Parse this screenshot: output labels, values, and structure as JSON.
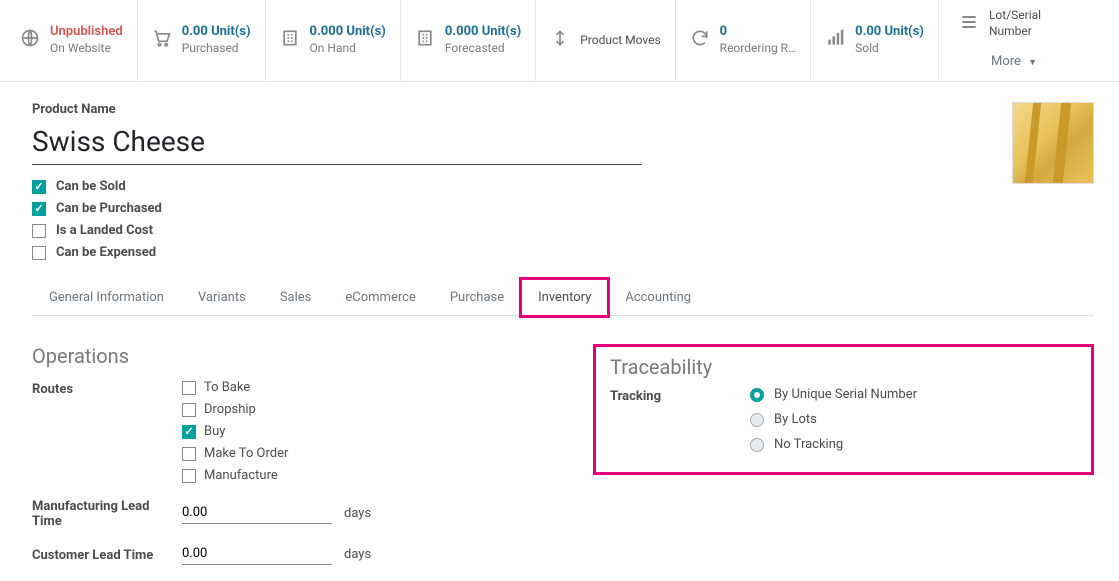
{
  "stats": {
    "website": {
      "status": "Unpublished",
      "label": "On Website"
    },
    "purchased": {
      "value": "0.00 Unit(s)",
      "label": "Purchased"
    },
    "onhand": {
      "value": "0.000 Unit(s)",
      "label": "On Hand"
    },
    "forecasted": {
      "value": "0.000 Unit(s)",
      "label": "Forecasted"
    },
    "moves": {
      "label": "Product Moves"
    },
    "reordering": {
      "value": "0",
      "label": "Reordering R…"
    },
    "sold": {
      "value": "0.00 Unit(s)",
      "label": "Sold"
    },
    "lotserial": {
      "line1": "Lot/Serial",
      "line2": "Number"
    },
    "more": "More"
  },
  "form": {
    "name_label": "Product Name",
    "name_value": "Swiss Cheese",
    "checkboxes": {
      "sold": {
        "label": "Can be Sold",
        "checked": true
      },
      "purchased": {
        "label": "Can be Purchased",
        "checked": true
      },
      "landed": {
        "label": "Is a Landed Cost",
        "checked": false
      },
      "expensed": {
        "label": "Can be Expensed",
        "checked": false
      }
    }
  },
  "tabs": {
    "general": "General Information",
    "variants": "Variants",
    "sales": "Sales",
    "ecommerce": "eCommerce",
    "purchase": "Purchase",
    "inventory": "Inventory",
    "accounting": "Accounting"
  },
  "inventory": {
    "operations_title": "Operations",
    "routes_label": "Routes",
    "routes": {
      "bake": {
        "label": "To Bake",
        "checked": false
      },
      "dropship": {
        "label": "Dropship",
        "checked": false
      },
      "buy": {
        "label": "Buy",
        "checked": true
      },
      "mto": {
        "label": "Make To Order",
        "checked": false
      },
      "manufacture": {
        "label": "Manufacture",
        "checked": false
      }
    },
    "mfg_lead_label": "Manufacturing Lead Time",
    "mfg_lead_value": "0.00",
    "cust_lead_label": "Customer Lead Time",
    "cust_lead_value": "0.00",
    "days_unit": "days",
    "traceability_title": "Traceability",
    "tracking_label": "Tracking",
    "tracking": {
      "serial": {
        "label": "By Unique Serial Number",
        "selected": true
      },
      "lots": {
        "label": "By Lots",
        "selected": false
      },
      "none": {
        "label": "No Tracking",
        "selected": false
      }
    }
  }
}
